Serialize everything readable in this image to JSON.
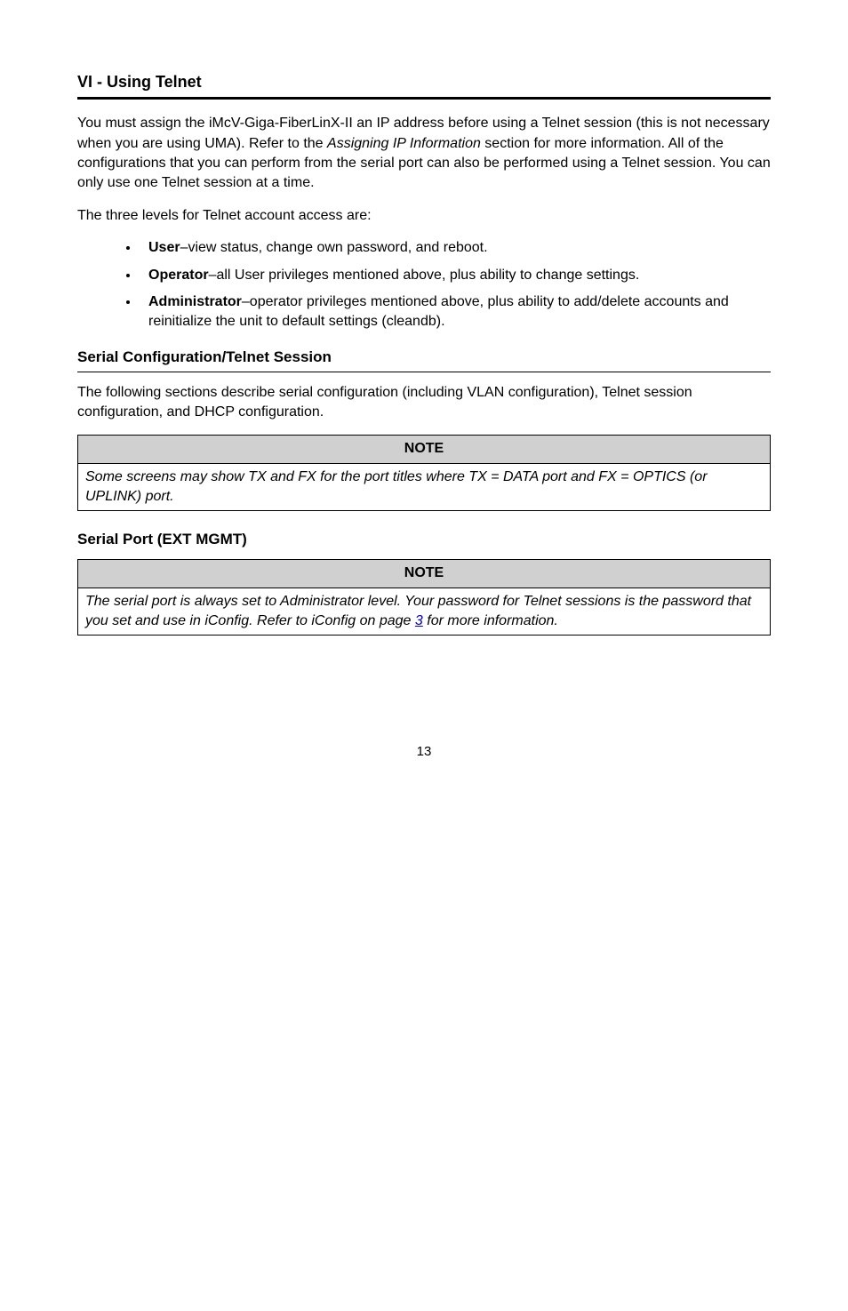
{
  "section1": {
    "title": "VI - Using Telnet",
    "p1_a": "You must assign the iMcV-Giga-FiberLinX-II an IP address before using a Telnet session (this is not necessary when you are using UMA).  Refer to the ",
    "p1_b": "Assigning IP Information",
    "p1_c": " section for more information.  All of the configurations that you can perform from the serial port can also be performed using a Telnet session.  You can only use one Telnet session at a time.",
    "p2": "The three levels for Telnet account access are:",
    "list": [
      {
        "term": "User",
        "desc": "–view status, change own password, and reboot."
      },
      {
        "term": "Operator",
        "desc": "–all User privileges mentioned above, plus ability to change settings."
      },
      {
        "term": "Administrator",
        "desc": "–operator privileges mentioned above, plus ability to add/delete accounts and reinitialize the unit to default settings (cleandb)."
      }
    ]
  },
  "section2": {
    "title": "Serial Configuration/Telnet Session",
    "p1": "The following sections describe serial configuration (including VLAN configuration), Telnet session configuration, and DHCP configuration.",
    "note_header": "NOTE",
    "note_body": "Some screens may show TX and FX for the port titles where TX = DATA port and FX = OPTICS (or UPLINK) port."
  },
  "section3": {
    "title": "Serial Port (EXT MGMT)",
    "note_header": "NOTE",
    "note_body_a": "The serial port is always set to Administrator level.  Your password for Telnet sessions is the password that you set and use in iConfig.  Refer to iConfig on page ",
    "note_link": "3",
    "note_body_b": " for more information."
  },
  "page_number": "13"
}
